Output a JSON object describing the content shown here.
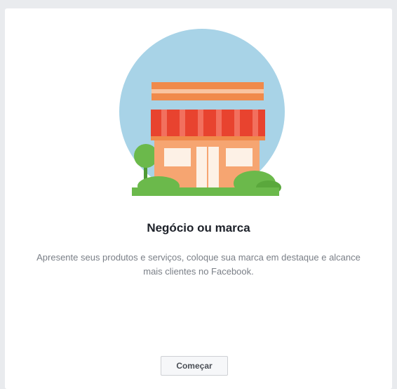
{
  "card": {
    "illustration_icon": "storefront-icon",
    "title": "Negócio ou marca",
    "description": "Apresente seus produtos e serviços, coloque sua marca em destaque e alcance mais clientes no Facebook.",
    "start_button_label": "Começar"
  },
  "colors": {
    "background": "#e9ebee",
    "card": "#ffffff",
    "circle": "#a8d3e7",
    "awning_red": "#e8432f",
    "storefront": "#f6a571",
    "roof": "#f08a4b",
    "bush_green": "#6bb94b"
  }
}
